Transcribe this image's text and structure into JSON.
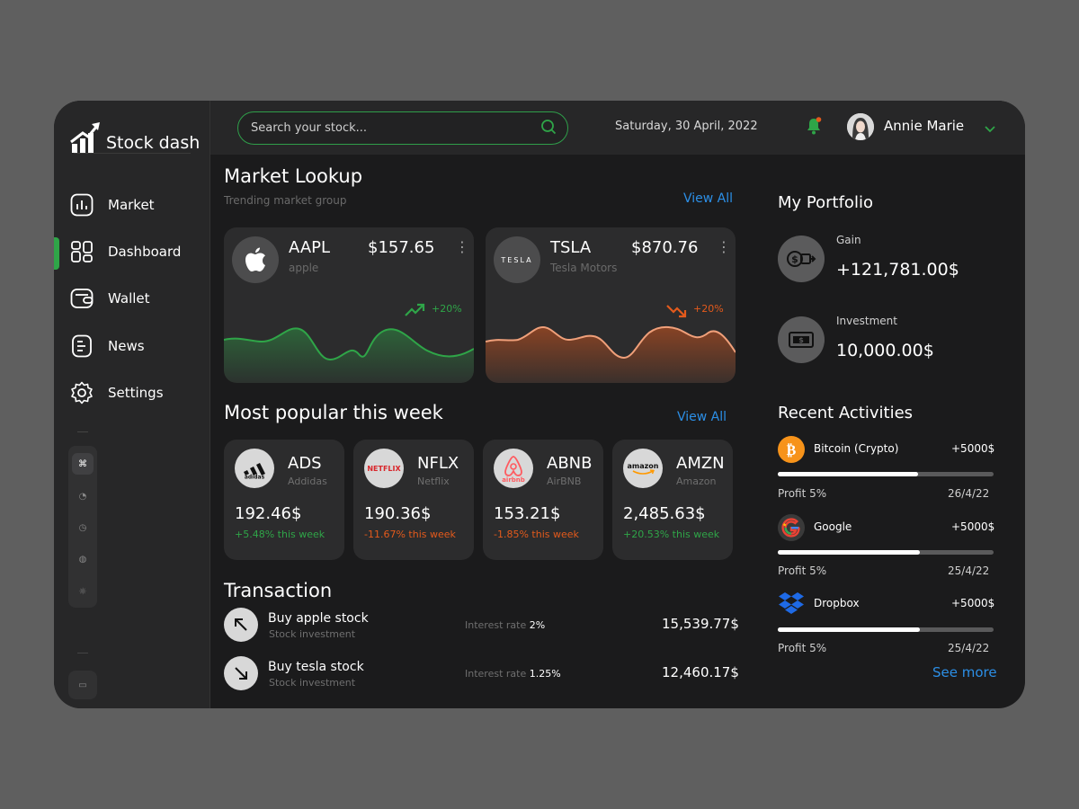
{
  "app": {
    "name": "Stock dash"
  },
  "sidebar": {
    "items": [
      {
        "label": "Market",
        "icon": "bar-chart-icon"
      },
      {
        "label": "Dashboard",
        "icon": "grid-icon",
        "active": true
      },
      {
        "label": "Wallet",
        "icon": "wallet-icon"
      },
      {
        "label": "News",
        "icon": "document-icon"
      },
      {
        "label": "Settings",
        "icon": "gear-icon"
      }
    ],
    "mini_buttons": [
      {
        "glyph": "⌘",
        "icon": "command-icon"
      },
      {
        "glyph": "◔",
        "icon": "pie-icon"
      },
      {
        "glyph": "◷",
        "icon": "clock-icon"
      },
      {
        "glyph": "◍",
        "icon": "globe-icon"
      },
      {
        "glyph": "☼",
        "icon": "sun-icon"
      }
    ],
    "chat_glyph": "▭"
  },
  "header": {
    "search_placeholder": "Search your stock...",
    "date": "Saturday, 30 April, 2022",
    "user_name": "Annie Marie"
  },
  "market": {
    "title": "Market Lookup",
    "subtitle": "Trending market group",
    "view_all": "View All",
    "cards": [
      {
        "ticker": "AAPL",
        "name": "apple",
        "price": "$157.65",
        "change": "+20%",
        "trend": "up",
        "color": "#2fa548",
        "kebab": "⋮",
        "logo": "apple-logo-icon"
      },
      {
        "ticker": "TSLA",
        "name": "Tesla Motors",
        "price": "$870.76",
        "change": "+20%",
        "trend": "down",
        "color": "#e35a1c",
        "kebab": "⋮",
        "logo_text": "TESLA"
      }
    ]
  },
  "popular": {
    "title": "Most popular this week",
    "view_all": "View All",
    "items": [
      {
        "ticker": "ADS",
        "name": "Addidas",
        "value": "192.46$",
        "change": "+5.48% this week",
        "logo": "adidas"
      },
      {
        "ticker": "NFLX",
        "name": "Netflix",
        "value": "190.36$",
        "change": "-11.67% this week",
        "logo": "NETFLIX"
      },
      {
        "ticker": "ABNB",
        "name": "AirBNB",
        "value": "153.21$",
        "change": "-1.85% this week",
        "logo": "airbnb"
      },
      {
        "ticker": "AMZN",
        "name": "Amazon",
        "value": "2,485.63$",
        "change": "+20.53% this week",
        "logo": "amazon"
      }
    ]
  },
  "transactions": {
    "title": "Transaction",
    "rate_label": "Interest rate",
    "items": [
      {
        "title": "Buy apple stock",
        "sub": "Stock investment",
        "rate": "2%",
        "amount": "15,539.77$"
      },
      {
        "title": "Buy tesla stock",
        "sub": "Stock investment",
        "rate": "1.25%",
        "amount": "12,460.17$"
      }
    ]
  },
  "portfolio": {
    "title": "My Portfolio",
    "gain_label": "Gain",
    "gain_value": "+121,781.00$",
    "investment_label": "Investment",
    "investment_value": "10,000.00$"
  },
  "activities": {
    "title": "Recent Activities",
    "see_more": "See more",
    "items": [
      {
        "name": "Bitcoin (Crypto)",
        "amount": "+5000$",
        "profit": "Profit 5%",
        "date": "26/4/22",
        "progress": 0.65,
        "icon": "bitcoin-icon"
      },
      {
        "name": "Google",
        "amount": "+5000$",
        "profit": "Profit 5%",
        "date": "25/4/22",
        "progress": 0.66,
        "icon": "google-icon"
      },
      {
        "name": "Dropbox",
        "amount": "+5000$",
        "profit": "Profit 5%",
        "date": "25/4/22",
        "progress": 0.66,
        "icon": "dropbox-icon"
      }
    ]
  },
  "colors": {
    "accent_green": "#2fa548",
    "accent_red": "#e35a1c",
    "link_blue": "#2c8fe6"
  }
}
